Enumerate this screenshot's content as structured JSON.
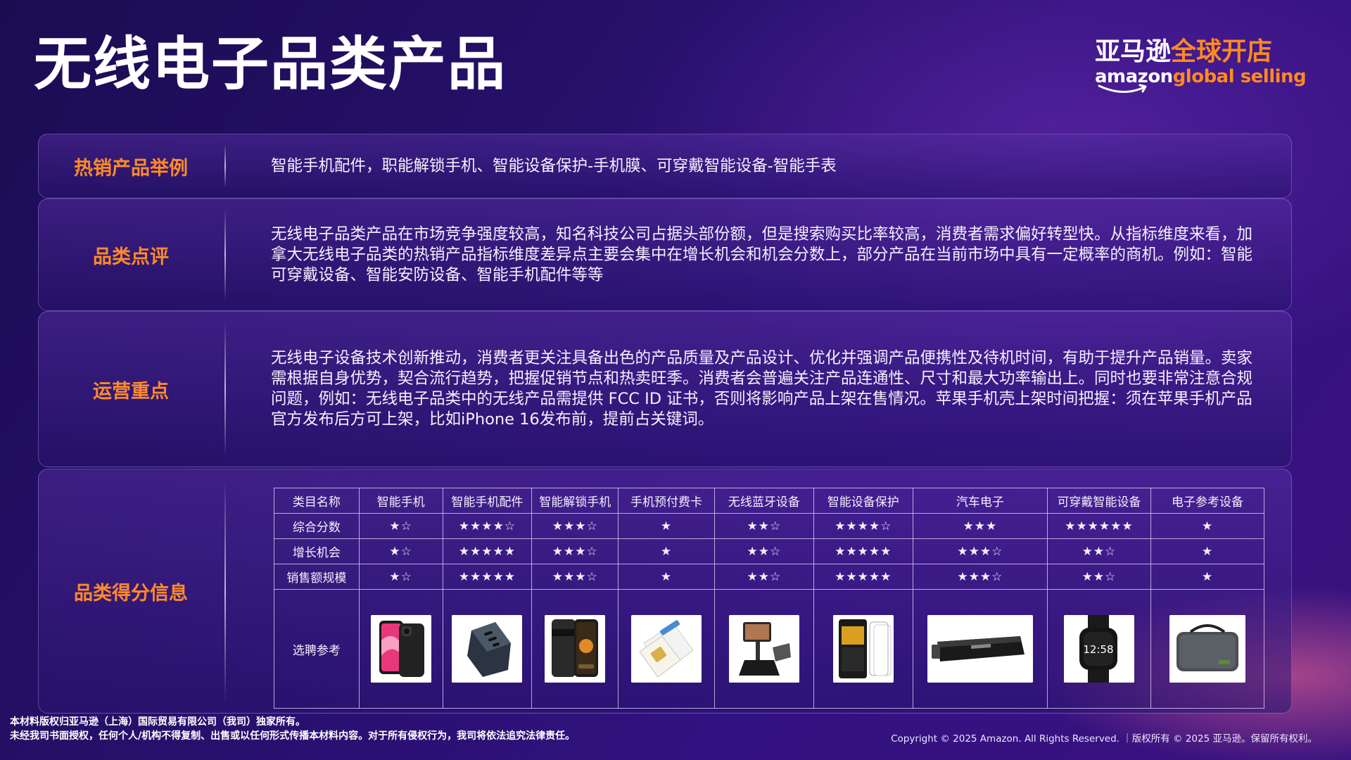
{
  "title": "无线电子品类产品",
  "logo": {
    "cn_white": "亚马逊",
    "cn_orange": "全球开店",
    "en_white": "amazon",
    "en_orange": "global selling"
  },
  "sections": {
    "hot_products": {
      "label": "热销产品举例",
      "text": "智能手机配件，职能解锁手机、智能设备保护-手机膜、可穿戴智能设备-智能手表"
    },
    "review": {
      "label": "品类点评",
      "text": "无线电子品类产品在市场竞争强度较高，知名科技公司占据头部份额，但是搜索购买比率较高，消费者需求偏好转型快。从指标维度来看，加拿大无线电子品类的热销产品指标维度差异点主要会集中在增长机会和机会分数上，部分产品在当前市场中具有一定概率的商机。例如：智能可穿戴设备、智能安防设备、智能手机配件等等"
    },
    "operations": {
      "label": "运营重点",
      "text": "无线电子设备技术创新推动，消费者更关注具备出色的产品质量及产品设计、优化并强调产品便携性及待机时间，有助于提升产品销量。卖家需根据自身优势，契合流行趋势，把握促销节点和热卖旺季。消费者会普遍关注产品连通性、尺寸和最大功率输出上。同时也要非常注意合规问题，例如：无线电子品类中的无线产品需提供 FCC ID 证书，否则将影响产品上架在售情况。苹果手机壳上架时间把握：须在苹果手机产品官方发布后方可上架，比如iPhone 16发布前，提前占关键词。"
    },
    "scores": {
      "label": "品类得分信息",
      "header": [
        "类目名称",
        "智能手机",
        "智能手机配件",
        "智能解锁手机",
        "手机预付费卡",
        "无线蓝牙设备",
        "智能设备保护",
        "汽车电子",
        "可穿戴智能设备",
        "电子参考设备"
      ],
      "rows": [
        {
          "name": "综合分数",
          "values": [
            "★☆",
            "★★★★☆",
            "★★★☆",
            "★",
            "★★☆",
            "★★★★☆",
            "★★★",
            "★★★★★★",
            "★"
          ]
        },
        {
          "name": "增长机会",
          "values": [
            "★☆",
            "★★★★★",
            "★★★☆",
            "★",
            "★★☆",
            "★★★★★",
            "★★★☆",
            "★★☆",
            "★"
          ]
        },
        {
          "name": "销售额规模",
          "values": [
            "★☆",
            "★★★★★",
            "★★★☆",
            "★",
            "★★☆",
            "★★★★★",
            "★★★☆",
            "★★☆",
            "★"
          ]
        }
      ],
      "reference_label": "选聘参考",
      "reference_images": [
        "smartphone-image",
        "charger-image",
        "unlocked-phone-image",
        "sim-card-image",
        "phone-stand-image",
        "screen-protector-image",
        "car-amplifier-image",
        "smartwatch-image",
        "electronics-case-image"
      ],
      "watch_time": "12:58"
    }
  },
  "footer": {
    "legal_line1": "本材料版权归亚马逊（上海）国际贸易有限公司（我司）独家所有。",
    "legal_line2": "未经我司书面授权，任何个人/机构不得复制、出售或以任何形式传播本材料内容。对于所有侵权行为，我司将依法追究法律责任。",
    "copyright": "Copyright © 2025 Amazon. All Rights Reserved. ｜版权所有 © 2025 亚马逊。保留所有权利。"
  }
}
